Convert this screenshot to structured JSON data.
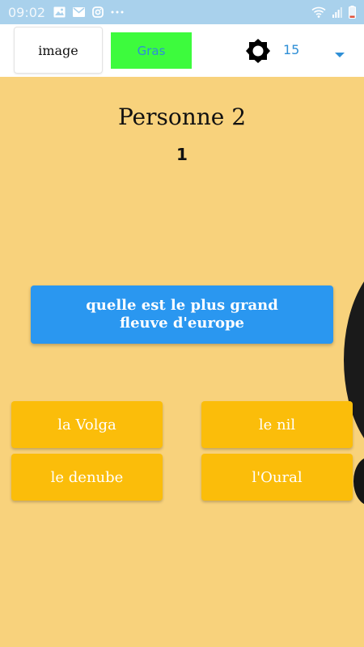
{
  "status_bar": {
    "time": "09:02",
    "background": "#a9d1ec",
    "left_icons": [
      "image-icon",
      "mail-icon",
      "instagram-icon",
      "more-icon"
    ],
    "right_icons": [
      "wifi-icon",
      "signal-icon",
      "battery-icon"
    ]
  },
  "toolbar": {
    "image_button_label": "image",
    "gras_button_label": "Gras",
    "gras_button_color": "#3dfb3d",
    "brightness_icon": "brightness-icon",
    "size_value": "15",
    "dropdown_icon": "dropdown-arrow-icon"
  },
  "game": {
    "player_name": "Personne 2",
    "score": "1",
    "question": "quelle est le plus grand fleuve d'europe",
    "question_color": "#2a97f0",
    "answer_color": "#fbbd0a",
    "answers": [
      "la Volga",
      "le nil",
      "le denube",
      "l'Oural"
    ]
  },
  "colors": {
    "background": "#f8d27c",
    "accent_text": "#2f8fd6"
  }
}
